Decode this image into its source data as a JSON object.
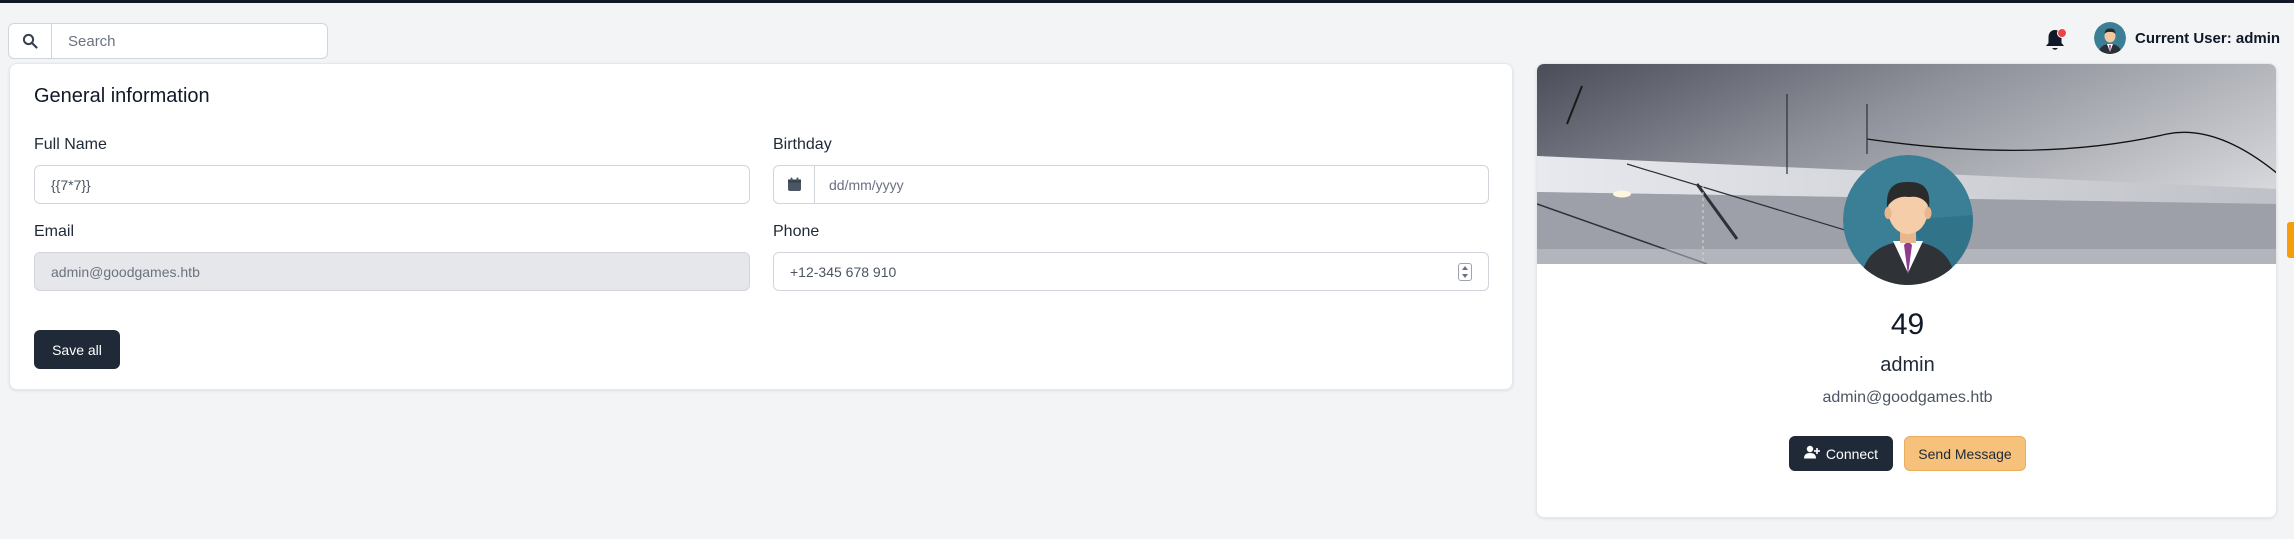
{
  "search": {
    "placeholder": "Search",
    "icon": "search-icon"
  },
  "header": {
    "user_label": "Current User: admin",
    "notification_icon": "bell-icon"
  },
  "form": {
    "title": "General information",
    "full_name": {
      "label": "Full Name",
      "value": "{{7*7}}"
    },
    "birthday": {
      "label": "Birthday",
      "placeholder": "dd/mm/yyyy",
      "icon": "calendar-icon"
    },
    "email": {
      "label": "Email",
      "value": "admin@goodgames.htb"
    },
    "phone": {
      "label": "Phone",
      "value": "+12-345 678 910"
    },
    "save_label": "Save all"
  },
  "profile": {
    "number": "49",
    "name": "admin",
    "email": "admin@goodgames.htb",
    "connect_label": "Connect",
    "message_label": "Send Message"
  },
  "colors": {
    "dark": "#1f2937",
    "accent": "#f6c17a",
    "notification": "#ef4444",
    "background": "#f2f4f6"
  }
}
